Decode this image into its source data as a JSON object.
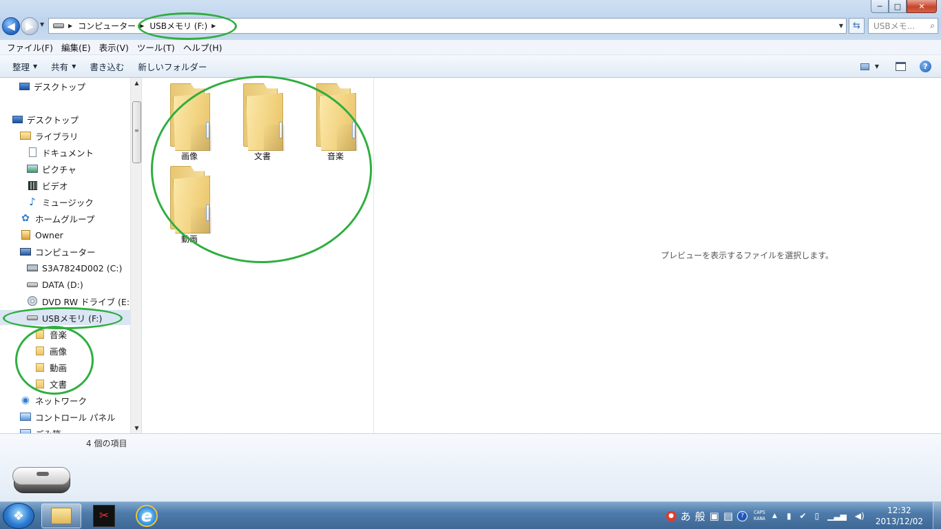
{
  "window": {
    "min": "─",
    "max": "□",
    "close": "✕"
  },
  "address": {
    "crumbs": [
      "コンピューター",
      "USBメモリ (F:)"
    ],
    "search_placeholder": "USBメモ..."
  },
  "menu": [
    "ファイル(F)",
    "編集(E)",
    "表示(V)",
    "ツール(T)",
    "ヘルプ(H)"
  ],
  "commands": {
    "organize": "整理",
    "share": "共有",
    "burn": "書き込む",
    "new_folder": "新しいフォルダー"
  },
  "nav_tree": [
    {
      "label": "デスクトップ",
      "icon": "desktop-icon"
    },
    {
      "label": "デスクトップ",
      "icon": "desktop-icon"
    },
    {
      "label": "ライブラリ",
      "icon": "library-icon"
    },
    {
      "label": "ドキュメント",
      "icon": "document-icon"
    },
    {
      "label": "ピクチャ",
      "icon": "pictures-icon"
    },
    {
      "label": "ビデオ",
      "icon": "video-icon"
    },
    {
      "label": "ミュージック",
      "icon": "music-icon"
    },
    {
      "label": "ホームグループ",
      "icon": "homegroup-icon"
    },
    {
      "label": "Owner",
      "icon": "user-folder-icon"
    },
    {
      "label": "コンピューター",
      "icon": "computer-icon"
    },
    {
      "label": "S3A7824D002 (C:)",
      "icon": "system-drive-icon"
    },
    {
      "label": "DATA (D:)",
      "icon": "drive-icon"
    },
    {
      "label": "DVD RW ドライブ (E:)",
      "icon": "dvd-drive-icon"
    },
    {
      "label": "USBメモリ (F:)",
      "icon": "usb-drive-icon"
    },
    {
      "label": "音楽",
      "icon": "folder-icon"
    },
    {
      "label": "画像",
      "icon": "folder-icon"
    },
    {
      "label": "動画",
      "icon": "folder-icon"
    },
    {
      "label": "文書",
      "icon": "folder-icon"
    },
    {
      "label": "ネットワーク",
      "icon": "network-icon"
    },
    {
      "label": "コントロール パネル",
      "icon": "control-panel-icon"
    },
    {
      "label": "ごみ箱",
      "icon": "recycle-bin-icon"
    }
  ],
  "files": [
    {
      "label": "画像"
    },
    {
      "label": "文書"
    },
    {
      "label": "音楽"
    },
    {
      "label": "動画"
    }
  ],
  "preview": {
    "message": "プレビューを表示するファイルを選択します。"
  },
  "details": {
    "count": "4 個の項目"
  },
  "taskbar": {
    "ime": [
      "あ",
      "般"
    ],
    "caps": "CAPS",
    "kana": "KANA",
    "time": "12:32",
    "date": "2013/12/02"
  },
  "colors": {
    "annotation": "#2fae3f",
    "selection": "#dbe6f4"
  }
}
